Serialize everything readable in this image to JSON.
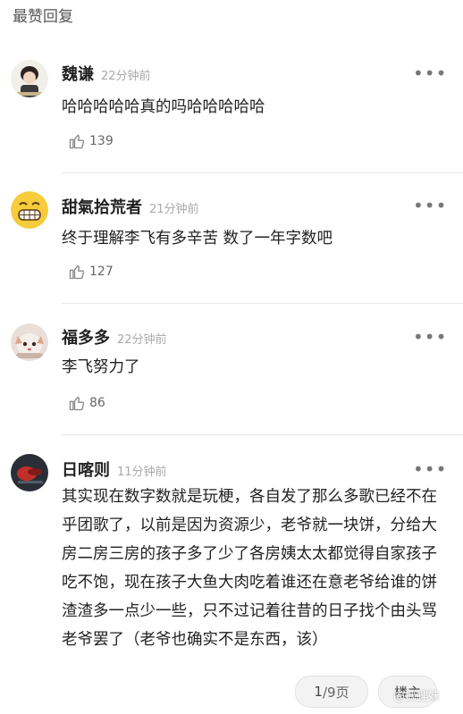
{
  "section_title": "最赞回复",
  "more_label": "•••",
  "comments": [
    {
      "name": "魏谦",
      "time": "22分钟前",
      "text": "哈哈哈哈哈真的吗哈哈哈哈哈",
      "likes": "139"
    },
    {
      "name": "甜氣拾荒者",
      "time": "21分钟前",
      "text": "终于理解李飞有多辛苦 数了一年字数吧",
      "likes": "127"
    },
    {
      "name": "福多多",
      "time": "22分钟前",
      "text": "李飞努力了",
      "likes": "86"
    },
    {
      "name": "日喀则",
      "time": "11分钟前",
      "text": "其实现在数字数就是玩梗，各自发了那么多歌已经不在乎团歌了，以前是因为资源少，老爷就一块饼，分给大房二房三房的孩子多了少了各房姨太太都觉得自家孩子吃不饱，现在孩子大鱼大肉吃着谁还在意老爷给谁的饼渣渣多一点少一些，只不过记着往昔的日子找个由头骂老爷罢了（老爷也确实不是东西，该）",
      "likes": ""
    }
  ],
  "pager": {
    "current": "1",
    "total": "/9页"
  },
  "louzhu_label": "楼主",
  "watermark": "@狐狸妹"
}
